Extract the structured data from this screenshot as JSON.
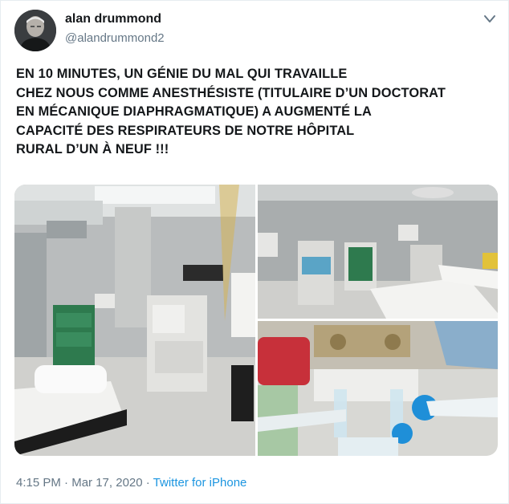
{
  "author": {
    "name": "alan drummond",
    "handle": "@alandrummond2",
    "avatar_icon": "profile-photo"
  },
  "tweet": {
    "text": "EN 10 MINUTES, UN GÉNIE DU MAL QUI TRAVAILLE\nCHEZ NOUS COMME ANESTHÉSISTE (TITULAIRE D’UN DOCTORAT\nEN MÉCANIQUE DIAPHRAGMATIQUE) A AUGMENTÉ LA\nCAPACITÉ DES RESPIRATEURS DE NOTRE HÔPITAL\nRURAL D’UN À NEUF !!!"
  },
  "media": {
    "photos": [
      {
        "subject": "operating room with anesthesia machine and stretcher"
      },
      {
        "subject": "second operating room with ventilators"
      },
      {
        "subject": "ventilator circuit split with blue connectors"
      }
    ]
  },
  "meta": {
    "time": "4:15 PM",
    "separator1": " · ",
    "date": "Mar 17, 2020",
    "separator2": " · ",
    "source": "Twitter for iPhone"
  },
  "colors": {
    "link": "#1b95e0",
    "secondary_text": "#657786",
    "border": "#e6ecf0"
  }
}
